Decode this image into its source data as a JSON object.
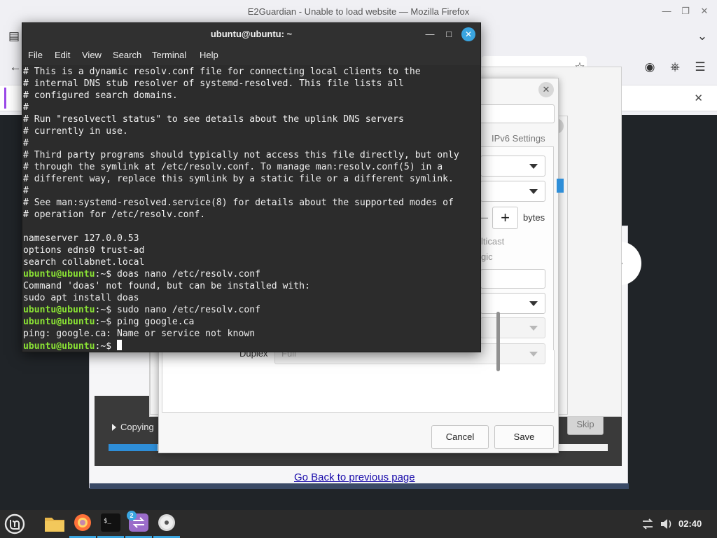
{
  "firefox": {
    "window_title": "E2Guardian - Unable to load website — Mozilla Firefox",
    "go_back_link": "Go Back to previous page"
  },
  "network_dialog": {
    "tab_ipv6": "IPv6 Settings",
    "mtu_unit": "bytes",
    "partial_multicast": "lticast",
    "partial_magic": "gic",
    "duplex_label": "Duplex",
    "duplex_value": "Full",
    "cancel_label": "Cancel",
    "save_label": "Save"
  },
  "installer": {
    "status": "Copying",
    "skip_label": "Skip",
    "progress_fraction": 0.098
  },
  "terminal": {
    "title": "ubuntu@ubuntu: ~",
    "menu": [
      "File",
      "Edit",
      "View",
      "Search",
      "Terminal",
      "Help"
    ],
    "prompt": "ubuntu@ubuntu",
    "lines": [
      {
        "text": "# This is a dynamic resolv.conf file for connecting local clients to the"
      },
      {
        "text": "# internal DNS stub resolver of systemd-resolved. This file lists all"
      },
      {
        "text": "# configured search domains."
      },
      {
        "text": "#"
      },
      {
        "text": "# Run \"resolvectl status\" to see details about the uplink DNS servers"
      },
      {
        "text": "# currently in use."
      },
      {
        "text": "#"
      },
      {
        "text": "# Third party programs should typically not access this file directly, but only"
      },
      {
        "text": "# through the symlink at /etc/resolv.conf. To manage man:resolv.conf(5) in a"
      },
      {
        "text": "# different way, replace this symlink by a static file or a different symlink."
      },
      {
        "text": "#"
      },
      {
        "text": "# See man:systemd-resolved.service(8) for details about the supported modes of"
      },
      {
        "text": "# operation for /etc/resolv.conf."
      },
      {
        "text": ""
      },
      {
        "text": "nameserver 127.0.0.53"
      },
      {
        "text": "options edns0 trust-ad"
      },
      {
        "text": "search collabnet.local"
      },
      {
        "prompt": true,
        "text": ":~$ doas nano /etc/resolv.conf"
      },
      {
        "text": "Command 'doas' not found, but can be installed with:"
      },
      {
        "text": "sudo apt install doas"
      },
      {
        "prompt": true,
        "text": ":~$ sudo nano /etc/resolv.conf"
      },
      {
        "prompt": true,
        "text": ":~$ ping google.ca"
      },
      {
        "text": "ping: google.ca: Name or service not known"
      },
      {
        "prompt": true,
        "text": ":~$ ",
        "cursor": true
      }
    ]
  },
  "taskbar": {
    "items": [
      {
        "icon": "mint-menu-icon"
      },
      {
        "icon": "files-folder-icon"
      },
      {
        "icon": "firefox-icon",
        "active": true
      },
      {
        "icon": "terminal-icon",
        "active": true
      },
      {
        "icon": "network-connections-icon",
        "active": true,
        "badge": "2"
      },
      {
        "icon": "disc-icon",
        "active": true
      }
    ],
    "clock": "02:40"
  }
}
